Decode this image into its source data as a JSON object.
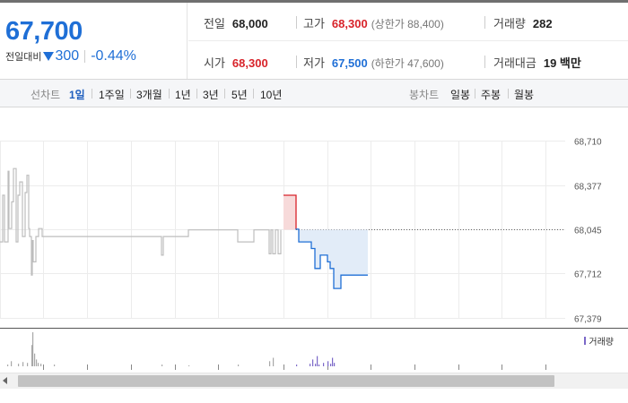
{
  "price": {
    "current": "67,700",
    "change_label": "전일대비",
    "change_amount": "300",
    "change_percent": "-0.44%"
  },
  "stats": {
    "prev_close": {
      "label": "전일",
      "value": "68,000"
    },
    "high": {
      "label": "고가",
      "value": "68,300",
      "limit": "(상한가 88,400)"
    },
    "volume": {
      "label": "거래량",
      "value": "282"
    },
    "open": {
      "label": "시가",
      "value": "68,300"
    },
    "low": {
      "label": "저가",
      "value": "67,500",
      "limit": "(하한가 47,600)"
    },
    "trade_value": {
      "label": "거래대금",
      "value": "19 백만"
    }
  },
  "line_chart_tabs": {
    "label": "선차트",
    "items": [
      "1일",
      "1주일",
      "3개월",
      "1년",
      "3년",
      "5년",
      "10년"
    ],
    "active_index": 0
  },
  "candle_chart_tabs": {
    "label": "봉차트",
    "items": [
      "일봉",
      "주봉",
      "월봉"
    ]
  },
  "colors": {
    "up": "#d8232a",
    "down": "#1f6fd6",
    "history_line": "#bdbdbd",
    "volume_bar": "#7b68c8"
  },
  "chart_data": {
    "type": "line",
    "y_ticks": [
      "68,710",
      "68,377",
      "68,045",
      "67,712",
      "67,379"
    ],
    "ylim": [
      67379,
      68710
    ],
    "reference_price": 68045,
    "volume_legend": "거래량",
    "history_series": {
      "x": [
        0,
        3,
        3,
        5,
        5,
        9,
        9,
        10,
        10,
        13,
        13,
        15,
        15,
        18,
        18,
        20,
        20,
        22,
        22,
        25,
        25,
        28,
        28,
        30,
        30,
        32,
        32,
        33,
        33,
        35,
        35,
        36,
        36,
        37,
        37,
        40,
        40,
        43,
        43,
        47,
        47,
        50,
        50,
        60,
        60,
        70,
        70,
        80,
        80,
        90,
        90,
        100,
        100,
        120,
        120,
        140,
        140,
        160,
        160,
        180,
        180,
        182,
        182,
        185,
        185,
        205,
        205,
        210,
        210,
        265,
        265,
        280,
        280,
        283,
        283,
        300,
        300,
        302,
        302,
        304,
        304,
        307,
        307,
        310,
        310,
        313,
        313
      ],
      "y": [
        67950,
        67950,
        68300,
        68300,
        67950,
        67950,
        68480,
        68480,
        68050,
        68050,
        68250,
        68250,
        68500,
        68500,
        67950,
        67950,
        68300,
        68300,
        68400,
        68400,
        67990,
        67990,
        68320,
        68320,
        68450,
        68450,
        68050,
        68050,
        67990,
        67990,
        67700,
        67700,
        67960,
        67960,
        67800,
        67800,
        67990,
        67990,
        68050,
        68050,
        67990,
        67990,
        67990,
        67990,
        67990,
        67990,
        67990,
        67990,
        67990,
        67990,
        67990,
        67990,
        67990,
        67990,
        67990,
        67990,
        67990,
        67990,
        67990,
        67990,
        67850,
        67850,
        67990,
        67990,
        67990,
        67990,
        67990,
        67990,
        68040,
        68040,
        67950,
        67950,
        67950,
        67950,
        68040,
        68040,
        67860,
        67860,
        68040,
        68040,
        67860,
        67860,
        68040,
        68040,
        67860,
        67860,
        68040
      ]
    },
    "today_series": {
      "x": [
        316,
        330,
        330,
        333,
        333,
        347,
        347,
        351,
        351,
        357,
        357,
        365,
        365,
        368,
        368,
        372,
        372,
        380,
        380,
        395,
        395,
        410
      ],
      "y": [
        68300,
        68300,
        68045,
        68045,
        67950,
        67950,
        67900,
        67900,
        67750,
        67750,
        67850,
        67850,
        67800,
        67800,
        67750,
        67750,
        67600,
        67600,
        67700,
        67700,
        67700,
        67700
      ]
    },
    "volume_series": {
      "x": [
        8,
        12,
        20,
        25,
        30,
        35,
        36,
        38,
        40,
        42,
        45,
        60,
        180,
        210,
        265,
        300,
        304,
        330,
        345,
        348,
        351,
        353,
        355,
        360,
        365,
        368,
        370,
        372
      ],
      "v": [
        2,
        6,
        3,
        5,
        4,
        25,
        40,
        15,
        8,
        4,
        3,
        2,
        2,
        1,
        2,
        6,
        10,
        2,
        3,
        8,
        3,
        12,
        2,
        4,
        6,
        3,
        10,
        4
      ]
    }
  }
}
